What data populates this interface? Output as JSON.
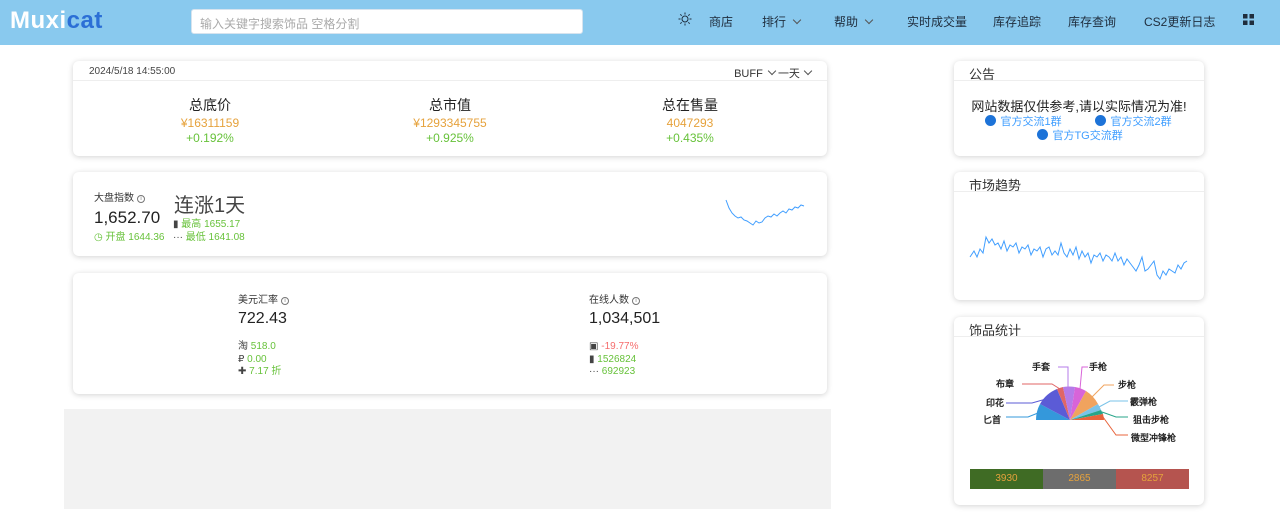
{
  "header": {
    "logo_part1": "Muxi",
    "logo_part2": "cat",
    "search_placeholder": "输入关键字搜索饰品 空格分割",
    "nav": {
      "shop": "商店",
      "ranking": "排行",
      "help": "帮助",
      "realtime": "实时成交量",
      "inventory_track": "库存追踪",
      "inventory_query": "库存查询",
      "cs2_log": "CS2更新日志"
    }
  },
  "summary": {
    "date": "2024/5/18 14:55:00",
    "platform": "BUFF",
    "period": "一天",
    "stats": [
      {
        "label": "总底价",
        "value": "¥16311159",
        "change": "+0.192%"
      },
      {
        "label": "总市值",
        "value": "¥1293345755",
        "change": "+0.925%"
      },
      {
        "label": "总在售量",
        "value": "4047293",
        "change": "+0.435%"
      }
    ]
  },
  "index": {
    "label": "大盘指数",
    "value": "1,652.70",
    "streak": "连涨1天",
    "open": "开盘 1644.36",
    "high": "最高 1655.17",
    "low": "最低 1641.08"
  },
  "exchange": {
    "label": "美元汇率",
    "value": "722.43",
    "tao": "518.0",
    "coin": "0.00",
    "discount": "7.17 折"
  },
  "online": {
    "label": "在线人数",
    "value": "1,034,501",
    "change": "-19.77%",
    "peak": "1526824",
    "low": "692923"
  },
  "notice": {
    "title": "公告",
    "text": "网站数据仅供参考,请以实际情况为准!",
    "group1": "官方交流1群",
    "group2": "官方交流2群",
    "tg": "官方TG交流群"
  },
  "trend": {
    "title": "市场趋势"
  },
  "item_stats": {
    "title": "饰品统计",
    "labels": {
      "gloves": "手套",
      "pistol": "手枪",
      "patch": "布章",
      "rifle": "步枪",
      "sticker": "印花",
      "shotgun": "霰弹枪",
      "knife": "匕首",
      "sniper": "狙击步枪",
      "smg": "微型冲锋枪"
    },
    "bar": [
      "3930",
      "2865",
      "8257"
    ],
    "colors": {
      "green": "#3f6b24",
      "gray": "#6d6d6d",
      "red": "#b5544f"
    }
  }
}
